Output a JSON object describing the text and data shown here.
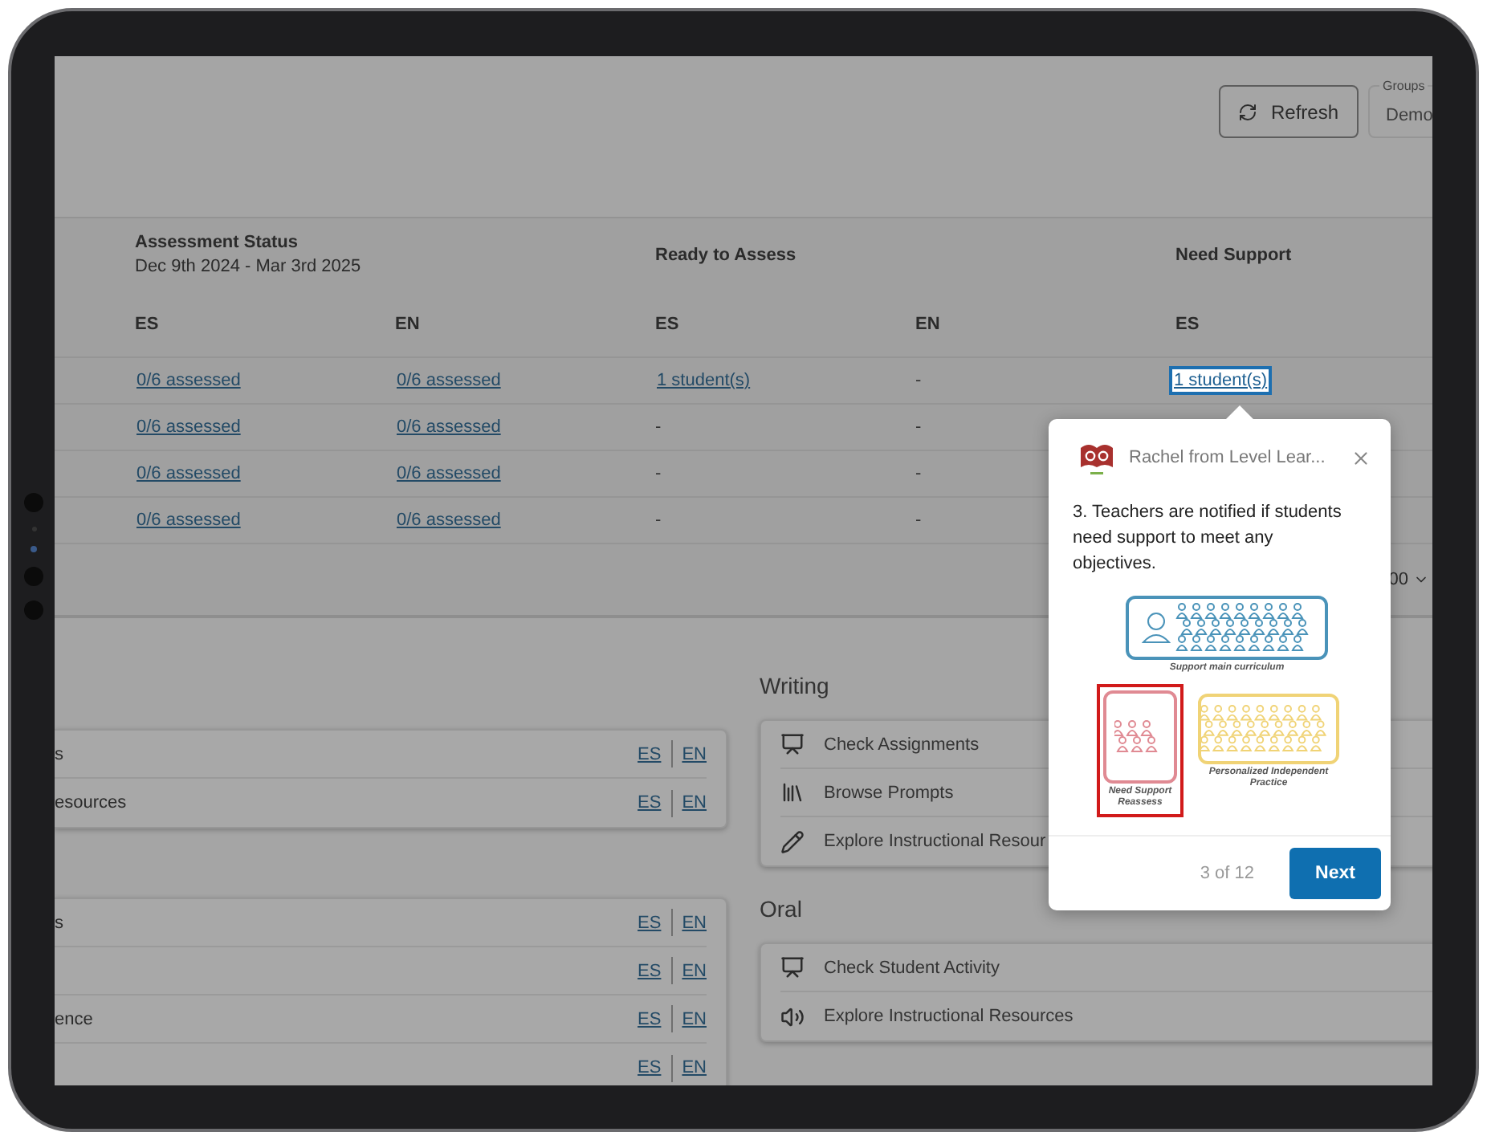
{
  "header": {
    "refresh_button": "Refresh",
    "groups_select": {
      "label": "Groups",
      "value": "Demo"
    }
  },
  "table": {
    "groups": [
      {
        "title": "Assessment Status",
        "subtitle": "Dec 9th 2024 - Mar 3rd 2025"
      },
      {
        "title": "Ready to Assess"
      },
      {
        "title": "Need Support"
      }
    ],
    "columns": [
      "ES",
      "EN",
      "ES",
      "EN",
      "ES"
    ],
    "rows": [
      [
        {
          "kind": "link",
          "text": "0/6 assessed"
        },
        {
          "kind": "link",
          "text": "0/6 assessed"
        },
        {
          "kind": "link",
          "text": "1 student(s)"
        },
        {
          "kind": "text",
          "text": "-"
        },
        {
          "kind": "link",
          "text": "1 student(s)",
          "spotlight": true
        }
      ],
      [
        {
          "kind": "link",
          "text": "0/6 assessed"
        },
        {
          "kind": "link",
          "text": "0/6 assessed"
        },
        {
          "kind": "text",
          "text": "-"
        },
        {
          "kind": "text",
          "text": "-"
        }
      ],
      [
        {
          "kind": "link",
          "text": "0/6 assessed"
        },
        {
          "kind": "link",
          "text": "0/6 assessed"
        },
        {
          "kind": "text",
          "text": "-"
        },
        {
          "kind": "text",
          "text": "-"
        }
      ],
      [
        {
          "kind": "link",
          "text": "0/6 assessed"
        },
        {
          "kind": "link",
          "text": "0/6 assessed"
        },
        {
          "kind": "text",
          "text": "-"
        },
        {
          "kind": "text",
          "text": "-"
        }
      ]
    ],
    "page_size": "00"
  },
  "left_cards": [
    {
      "rows": [
        {
          "label": "s",
          "links": [
            "ES",
            "EN"
          ]
        },
        {
          "label": "esources",
          "links": [
            "ES",
            "EN"
          ]
        }
      ]
    },
    {
      "rows": [
        {
          "label": "s",
          "links": [
            "ES",
            "EN"
          ]
        },
        {
          "links": [
            "ES",
            "EN"
          ]
        },
        {
          "label": "ence",
          "links": [
            "ES",
            "EN"
          ]
        },
        {
          "links": [
            "ES",
            "EN"
          ]
        }
      ]
    }
  ],
  "sections": [
    {
      "title": "Writing",
      "items": [
        {
          "kind": "assign",
          "label": "Check Assignments"
        },
        {
          "kind": "books",
          "label": "Browse Prompts"
        },
        {
          "kind": "pencil",
          "label": "Explore Instructional Resour"
        }
      ]
    },
    {
      "title": "Oral",
      "items": [
        {
          "kind": "assign",
          "label": "Check Student Activity"
        },
        {
          "kind": "speaker",
          "label": "Explore Instructional Resources"
        }
      ]
    }
  ],
  "popover": {
    "sender": "Rachel from Level Lear...",
    "message": "3. Teachers are notified if students need support to meet any objectives.",
    "illustration": [
      {
        "caption": "Support main curriculum",
        "color": "#4a93b9",
        "highlighted": false
      },
      {
        "caption": "Need Support Reassess",
        "color": "#e08a93",
        "highlighted": true
      },
      {
        "caption": "Personalized Independent Practice",
        "color": "#f0d376",
        "highlighted": false
      }
    ],
    "progress": "3 of 12",
    "next_button": "Next"
  }
}
